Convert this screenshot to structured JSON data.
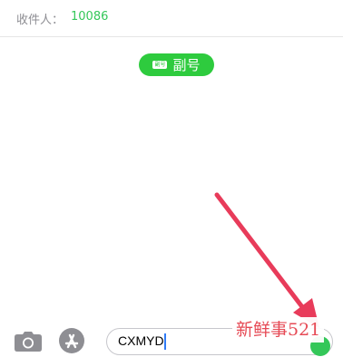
{
  "header": {
    "recipient_label": "收件人：",
    "recipient_number": "10086"
  },
  "badge": {
    "icon_text": "副号",
    "label": "副号"
  },
  "composer": {
    "input_value": "CXMYD"
  },
  "overlay": {
    "watermark_text": "新鲜事521"
  },
  "colors": {
    "accent_green": "#34C759",
    "badge_green": "#2ECB3E",
    "arrow_red": "#E83B5A",
    "watermark_red": "#E64A55"
  }
}
